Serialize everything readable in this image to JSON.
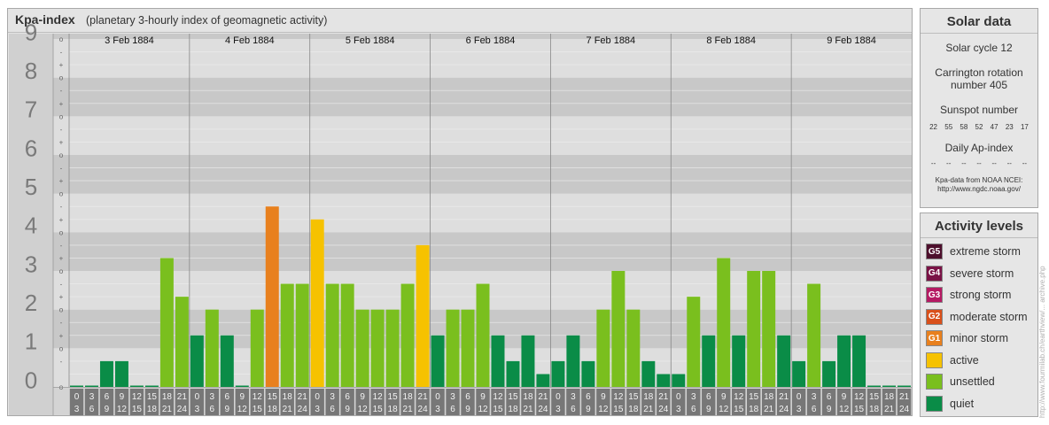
{
  "header": {
    "title": "Kpa-index",
    "subtitle": "(planetary 3-hourly index of geomagnetic activity)"
  },
  "chart_data": {
    "type": "bar",
    "title": "Kpa-index",
    "subtitle": "(planetary 3-hourly index of geomagnetic activity)",
    "ylim": [
      0,
      9
    ],
    "y_ticks": [
      "0",
      "1",
      "2",
      "3",
      "4",
      "5",
      "6",
      "7",
      "8",
      "9"
    ],
    "minor_marks": [
      "o",
      "+",
      "-"
    ],
    "days": [
      "3 Feb 1884",
      "4 Feb 1884",
      "5 Feb 1884",
      "6 Feb 1884",
      "7 Feb 1884",
      "8 Feb 1884",
      "9 Feb 1884"
    ],
    "hour_ranges": [
      [
        "0",
        "3"
      ],
      [
        "3",
        "6"
      ],
      [
        "6",
        "9"
      ],
      [
        "9",
        "12"
      ],
      [
        "12",
        "15"
      ],
      [
        "15",
        "18"
      ],
      [
        "18",
        "21"
      ],
      [
        "21",
        "24"
      ]
    ],
    "values": [
      [
        0,
        0,
        0.667,
        0.667,
        0,
        0,
        3.333,
        2.333
      ],
      [
        1.333,
        2,
        1.333,
        0,
        2,
        4.667,
        2.667,
        2.667
      ],
      [
        4.333,
        2.667,
        2.667,
        2,
        2,
        2,
        2.667,
        3.667
      ],
      [
        1.333,
        2,
        2,
        2.667,
        1.333,
        0.667,
        1.333,
        0.333
      ],
      [
        0.667,
        1.333,
        0.667,
        2,
        3,
        2,
        0.667,
        0.333
      ],
      [
        0.333,
        2.333,
        1.333,
        3.333,
        1.333,
        3,
        3,
        1.333
      ],
      [
        0.667,
        2.667,
        0.667,
        1.333,
        1.333,
        0,
        0,
        0
      ]
    ],
    "grid": true,
    "legend_position": "right"
  },
  "solar": {
    "title": "Solar data",
    "cycle": "Solar cycle 12",
    "carrington_line1": "Carrington rotation",
    "carrington_line2": "number 405",
    "sunspot_label": "Sunspot number",
    "sunspots": [
      "22",
      "55",
      "58",
      "52",
      "47",
      "23",
      "17"
    ],
    "ap_label": "Daily Ap-index",
    "ap_values": [
      "--",
      "--",
      "--",
      "--",
      "--",
      "--",
      "--"
    ],
    "source_line1": "Kpa-data from NOAA NCEI:",
    "source_line2": "http://www.ngdc.noaa.gov/"
  },
  "legend": {
    "title": "Activity levels",
    "items": [
      {
        "code": "G5",
        "label": "extreme storm",
        "color": "#4d0f2c"
      },
      {
        "code": "G4",
        "label": "severe storm",
        "color": "#7a1246"
      },
      {
        "code": "G3",
        "label": "strong storm",
        "color": "#b51a63"
      },
      {
        "code": "G2",
        "label": "moderate storm",
        "color": "#d9501b"
      },
      {
        "code": "G1",
        "label": "minor storm",
        "color": "#e8801e"
      },
      {
        "code": "",
        "label": "active",
        "color": "#f6c200"
      },
      {
        "code": "",
        "label": "unsettled",
        "color": "#7abf1e"
      },
      {
        "code": "",
        "label": "quiet",
        "color": "#0a8c47"
      }
    ]
  },
  "colors": {
    "quiet": "#0a8c47",
    "unsettled": "#7abf1e",
    "active": "#f6c200",
    "g1": "#e8801e",
    "g2": "#d9501b",
    "g3": "#b51a63",
    "g4": "#7a1246",
    "g5": "#4d0f2c"
  },
  "watermark": "http://www.fourmilab.ch/earthview/... archive.php"
}
